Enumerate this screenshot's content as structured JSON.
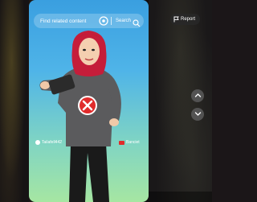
{
  "search": {
    "placeholder": "Find related content",
    "button_label": "Search",
    "icons": [
      "lens-icon",
      "search-icon"
    ]
  },
  "overlay": {
    "report_label": "Report",
    "report_icon": "flag-icon",
    "nav_up_icon": "chevron-up-icon",
    "nav_down_icon": "chevron-down-icon"
  },
  "video": {
    "watermark_left": "Tailafell442",
    "watermark_right": "Banciet",
    "gradient_top": "#3a9fe0",
    "gradient_bottom": "#a6e6a2",
    "badge_color": "#e02b2b"
  }
}
